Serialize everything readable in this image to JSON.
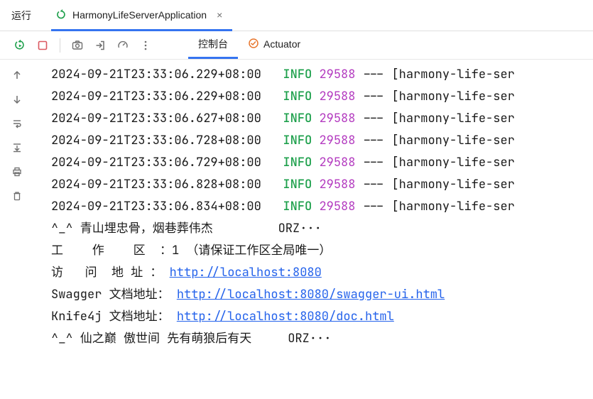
{
  "header": {
    "title": "运行",
    "tab_label": "HarmonyLifeServerApplication"
  },
  "toolbar": {
    "tab_console": "控制台",
    "tab_actuator": "Actuator"
  },
  "logs": [
    {
      "ts": "2024-09-21T23:33:06.229+08:00",
      "level": "INFO",
      "pid": "29588",
      "src": "[harmony-life-ser"
    },
    {
      "ts": "2024-09-21T23:33:06.229+08:00",
      "level": "INFO",
      "pid": "29588",
      "src": "[harmony-life-ser"
    },
    {
      "ts": "2024-09-21T23:33:06.627+08:00",
      "level": "INFO",
      "pid": "29588",
      "src": "[harmony-life-ser"
    },
    {
      "ts": "2024-09-21T23:33:06.728+08:00",
      "level": "INFO",
      "pid": "29588",
      "src": "[harmony-life-ser"
    },
    {
      "ts": "2024-09-21T23:33:06.729+08:00",
      "level": "INFO",
      "pid": "29588",
      "src": "[harmony-life-ser"
    },
    {
      "ts": "2024-09-21T23:33:06.828+08:00",
      "level": "INFO",
      "pid": "29588",
      "src": "[harmony-life-ser"
    },
    {
      "ts": "2024-09-21T23:33:06.834+08:00",
      "level": "INFO",
      "pid": "29588",
      "src": "[harmony-life-ser"
    }
  ],
  "banner": {
    "line1_pre": "^_^ 青山埋忠骨，烟巷葬伟杰         ORZ···",
    "work_label": "工    作    区  ：",
    "work_value": "1",
    "work_hint": "（请保证工作区全局唯一）",
    "addr_label": "访   问  地 址 ：",
    "addr_url": "http://localhost:8080",
    "swagger_label": "Swagger 文档地址：",
    "swagger_url": "http://localhost:8080/swagger-ui.html",
    "knife_label": "Knife4j 文档地址：",
    "knife_url": "http://localhost:8080/doc.html",
    "line_end": "^_^ 仙之巅 傲世间 先有萌狼后有天     ORZ···"
  }
}
